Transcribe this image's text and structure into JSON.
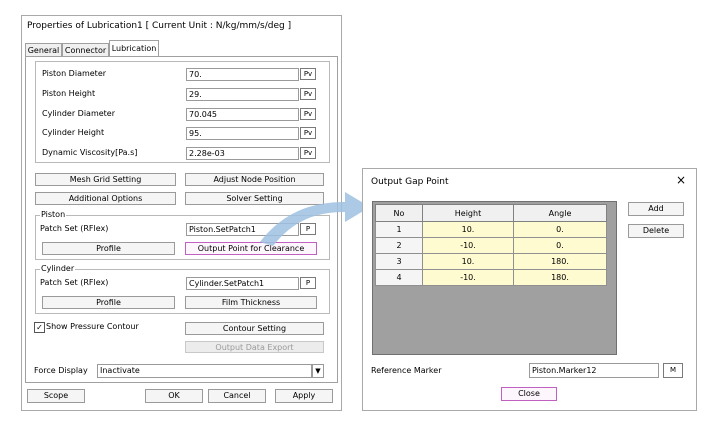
{
  "props": {
    "title": "Properties of Lubrication1 [ Current Unit : N/kg/mm/s/deg ]",
    "tabs": [
      "General",
      "Connector",
      "Lubrication"
    ],
    "fields": [
      {
        "label": "Piston Diameter",
        "value": "70.",
        "btn": "Pv"
      },
      {
        "label": "Piston Height",
        "value": "29.",
        "btn": "Pv"
      },
      {
        "label": "Cylinder Diameter",
        "value": "70.045",
        "btn": "Pv"
      },
      {
        "label": "Cylinder Height",
        "value": "95.",
        "btn": "Pv"
      },
      {
        "label": "Dynamic Viscosity[Pa.s]",
        "value": "2.28e-03",
        "btn": "Pv"
      }
    ],
    "mesh_grid": "Mesh Grid Setting",
    "adjust_node": "Adjust Node Position",
    "additional": "Additional Options",
    "solver": "Solver Setting",
    "piston": {
      "title": "Piston",
      "patch_label": "Patch Set (RFlex)",
      "patch_value": "Piston.SetPatch1",
      "p_btn": "P",
      "profile": "Profile",
      "output_point": "Output Point for Clearance"
    },
    "cylinder": {
      "title": "Cylinder",
      "patch_label": "Patch Set (RFlex)",
      "patch_value": "Cylinder.SetPatch1",
      "p_btn": "P",
      "profile": "Profile",
      "film": "Film Thickness"
    },
    "show_pressure": "Show Pressure Contour",
    "contour_setting": "Contour Setting",
    "output_export": "Output Data Export",
    "force_label": "Force Display",
    "force_value": "Inactivate",
    "scope": "Scope",
    "ok": "OK",
    "cancel": "Cancel",
    "apply": "Apply"
  },
  "gap": {
    "title": "Output Gap Point",
    "close_x": "×",
    "headers": [
      "No",
      "Height",
      "Angle"
    ],
    "rows": [
      [
        "1",
        "10.",
        "0."
      ],
      [
        "2",
        "-10.",
        "0."
      ],
      [
        "3",
        "10.",
        "180."
      ],
      [
        "4",
        "-10.",
        "180."
      ]
    ],
    "add": "Add",
    "delete": "Delete",
    "ref_label": "Reference Marker",
    "ref_value": "Piston.Marker12",
    "m_btn": "M",
    "close": "Close"
  },
  "colors": {
    "cell_bg": "#fffbd0",
    "arrow": "#9ebfe0",
    "highlight": "#c060c0"
  }
}
